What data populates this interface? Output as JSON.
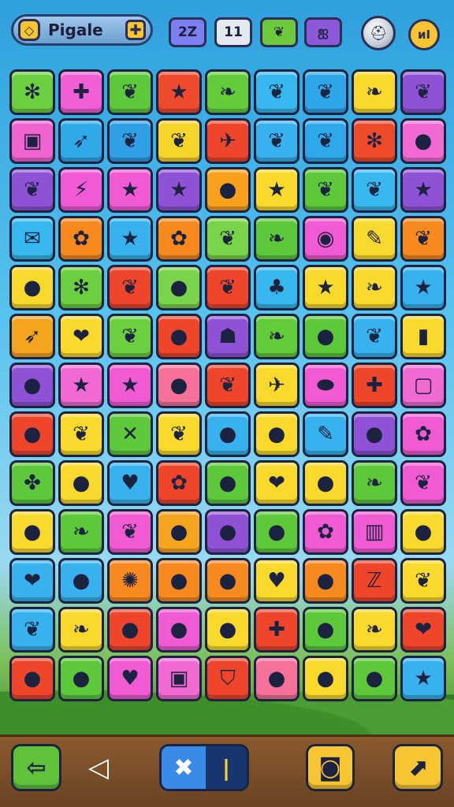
{
  "header": {
    "title": "Pigale",
    "title_badge_icon": "diamond-gem-icon",
    "add_icon": "plus-icon",
    "counters": [
      {
        "value": "2Z",
        "color": "#7b7ff0"
      },
      {
        "value": "11",
        "color": "#e4e8ef"
      },
      {
        "value": "",
        "color": "#6cc93c",
        "icon": "leaf-icon"
      },
      {
        "value": "",
        "color": "#8c5ad8",
        "icon": "bow-icon"
      }
    ],
    "helmet_icon": "helmet-icon",
    "sound_label": "ᴎI"
  },
  "board": {
    "rows": 13,
    "cols": 9,
    "tiles": [
      [
        {
          "c": "#6ccf3f",
          "g": "✻"
        },
        {
          "c": "#f05fd6",
          "g": "✚"
        },
        {
          "c": "#5cc83a",
          "g": "❦"
        },
        {
          "c": "#ee4a2c",
          "g": "★"
        },
        {
          "c": "#63cc3b",
          "g": "❧"
        },
        {
          "c": "#37b8ee",
          "g": "❦"
        },
        {
          "c": "#2ea6ea",
          "g": "❦"
        },
        {
          "c": "#f8d92c",
          "g": "❧"
        },
        {
          "c": "#8f52d6",
          "g": "❦"
        }
      ],
      [
        {
          "c": "#f064cf",
          "g": "▣"
        },
        {
          "c": "#31a8e8",
          "g": "➶"
        },
        {
          "c": "#2f9fe6",
          "g": "❦"
        },
        {
          "c": "#f6d52b",
          "g": "❦"
        },
        {
          "c": "#ee452b",
          "g": "✈"
        },
        {
          "c": "#37b2ee",
          "g": "❦"
        },
        {
          "c": "#2ea8ea",
          "g": "❦"
        },
        {
          "c": "#ee4b2b",
          "g": "✻"
        },
        {
          "c": "#f06ad2",
          "g": "●"
        }
      ],
      [
        {
          "c": "#8f52d6",
          "g": "❦"
        },
        {
          "c": "#f05ad6",
          "g": "⚡"
        },
        {
          "c": "#f05ad2",
          "g": "★"
        },
        {
          "c": "#8f52d6",
          "g": "★"
        },
        {
          "c": "#f9a11f",
          "g": "●"
        },
        {
          "c": "#f8d92c",
          "g": "★"
        },
        {
          "c": "#5cc83a",
          "g": "❦"
        },
        {
          "c": "#37b8ee",
          "g": "❦"
        },
        {
          "c": "#8f52d6",
          "g": "★"
        }
      ],
      [
        {
          "c": "#37b8ee",
          "g": "✉"
        },
        {
          "c": "#f68a1f",
          "g": "✿"
        },
        {
          "c": "#37b2ee",
          "g": "★"
        },
        {
          "c": "#f68a1f",
          "g": "✿"
        },
        {
          "c": "#7ad44a",
          "g": "❦"
        },
        {
          "c": "#5cc83a",
          "g": "❧"
        },
        {
          "c": "#f05ad2",
          "g": "◉"
        },
        {
          "c": "#f8d92c",
          "g": "✎"
        },
        {
          "c": "#f68a1f",
          "g": "❦"
        }
      ],
      [
        {
          "c": "#f8d92c",
          "g": "●"
        },
        {
          "c": "#6ccf3f",
          "g": "✻"
        },
        {
          "c": "#ee452b",
          "g": "❦"
        },
        {
          "c": "#7ad44a",
          "g": "●"
        },
        {
          "c": "#ee452b",
          "g": "❦"
        },
        {
          "c": "#37b8ee",
          "g": "♣"
        },
        {
          "c": "#f8d92c",
          "g": "★"
        },
        {
          "c": "#f8d92c",
          "g": "❧"
        },
        {
          "c": "#37b2ee",
          "g": "★"
        }
      ],
      [
        {
          "c": "#f6a31f",
          "g": "➶"
        },
        {
          "c": "#f8d92c",
          "g": "❤"
        },
        {
          "c": "#6ccf3f",
          "g": "❦"
        },
        {
          "c": "#ee452b",
          "g": "●"
        },
        {
          "c": "#8f52d6",
          "g": "☗"
        },
        {
          "c": "#63cc3b",
          "g": "❧"
        },
        {
          "c": "#5cc83a",
          "g": "●"
        },
        {
          "c": "#37b2ee",
          "g": "❦"
        },
        {
          "c": "#f8d92c",
          "g": "▮"
        }
      ],
      [
        {
          "c": "#8f52d6",
          "g": "●"
        },
        {
          "c": "#f06ad2",
          "g": "★"
        },
        {
          "c": "#f05ad2",
          "g": "★"
        },
        {
          "c": "#f5719a",
          "g": "●"
        },
        {
          "c": "#ee452b",
          "g": "❦"
        },
        {
          "c": "#f8d92c",
          "g": "✈"
        },
        {
          "c": "#f05ad2",
          "g": "⬬"
        },
        {
          "c": "#ee452b",
          "g": "✚"
        },
        {
          "c": "#f06ad2",
          "g": "▢"
        }
      ],
      [
        {
          "c": "#ee452b",
          "g": "●"
        },
        {
          "c": "#f8d92c",
          "g": "❦"
        },
        {
          "c": "#5cc83a",
          "g": "✕"
        },
        {
          "c": "#f8d92c",
          "g": "❦"
        },
        {
          "c": "#37b2ee",
          "g": "●"
        },
        {
          "c": "#f8d92c",
          "g": "●"
        },
        {
          "c": "#37b2ee",
          "g": "✎"
        },
        {
          "c": "#8f52d6",
          "g": "●"
        },
        {
          "c": "#f05ad2",
          "g": "✿"
        }
      ],
      [
        {
          "c": "#5cc83a",
          "g": "✤"
        },
        {
          "c": "#f8d92c",
          "g": "●"
        },
        {
          "c": "#37b2ee",
          "g": "♥"
        },
        {
          "c": "#ee452b",
          "g": "✿"
        },
        {
          "c": "#5cc83a",
          "g": "●"
        },
        {
          "c": "#f8d92c",
          "g": "❤"
        },
        {
          "c": "#f8d92c",
          "g": "●"
        },
        {
          "c": "#5cc83a",
          "g": "❧"
        },
        {
          "c": "#f05ad2",
          "g": "❦"
        }
      ],
      [
        {
          "c": "#f8d92c",
          "g": "●"
        },
        {
          "c": "#5cc83a",
          "g": "❧"
        },
        {
          "c": "#f05ad2",
          "g": "❦"
        },
        {
          "c": "#f6a31f",
          "g": "●"
        },
        {
          "c": "#8f52d6",
          "g": "●"
        },
        {
          "c": "#5cc83a",
          "g": "●"
        },
        {
          "c": "#f05ad2",
          "g": "✿"
        },
        {
          "c": "#f05ad2",
          "g": "▥"
        },
        {
          "c": "#f8d92c",
          "g": "●"
        }
      ],
      [
        {
          "c": "#37b2ee",
          "g": "❤"
        },
        {
          "c": "#37b2ee",
          "g": "●"
        },
        {
          "c": "#f68a1f",
          "g": "✺"
        },
        {
          "c": "#f68a1f",
          "g": "●"
        },
        {
          "c": "#f68a1f",
          "g": "●"
        },
        {
          "c": "#f8d92c",
          "g": "♥"
        },
        {
          "c": "#f68a1f",
          "g": "●"
        },
        {
          "c": "#ee452b",
          "g": "ℤ"
        },
        {
          "c": "#f8d92c",
          "g": "❦"
        }
      ],
      [
        {
          "c": "#37b2ee",
          "g": "❦"
        },
        {
          "c": "#f8d92c",
          "g": "❧"
        },
        {
          "c": "#ee452b",
          "g": "●"
        },
        {
          "c": "#f05ad2",
          "g": "●"
        },
        {
          "c": "#f8d92c",
          "g": "●"
        },
        {
          "c": "#ee452b",
          "g": "✚"
        },
        {
          "c": "#5cc83a",
          "g": "●"
        },
        {
          "c": "#f8d92c",
          "g": "❧"
        },
        {
          "c": "#ee452b",
          "g": "❤"
        }
      ],
      [
        {
          "c": "#ee452b",
          "g": "●"
        },
        {
          "c": "#5cc83a",
          "g": "●"
        },
        {
          "c": "#f05ad2",
          "g": "♥"
        },
        {
          "c": "#f06ad2",
          "g": "▣"
        },
        {
          "c": "#ee452b",
          "g": "⛉"
        },
        {
          "c": "#f5719a",
          "g": "●"
        },
        {
          "c": "#f8d92c",
          "g": "●"
        },
        {
          "c": "#5cc83a",
          "g": "●"
        },
        {
          "c": "#37b2ee",
          "g": "★"
        }
      ]
    ]
  },
  "footer": {
    "back_icon": "arrow-left-icon",
    "back_glyph": "⇦",
    "share_icon": "share-icon",
    "share_glyph": "◁",
    "toggle_off_glyph": "✖",
    "toggle_on_glyph": "|",
    "camera_icon": "camera-icon",
    "camera_glyph": "◙",
    "next_icon": "arrow-up-right-icon",
    "next_glyph": "⬈"
  }
}
